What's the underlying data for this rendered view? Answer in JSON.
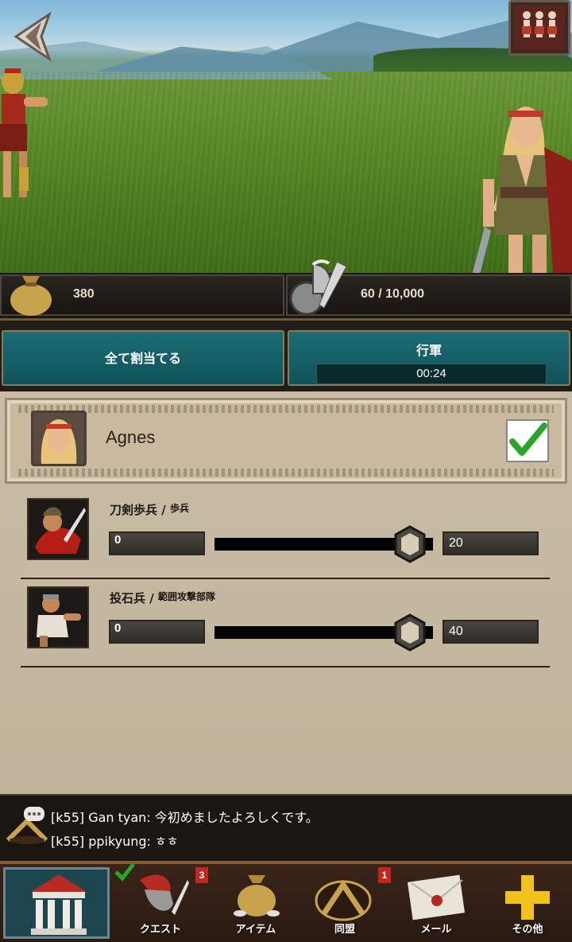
{
  "resources": {
    "gold": "380",
    "troops": "60 / 10,000"
  },
  "actions": {
    "assign_all": "全て割当てる",
    "march": "行軍",
    "march_timer": "00:24"
  },
  "hero": {
    "name": "Agnes",
    "selected": true
  },
  "units": [
    {
      "name": "刀剣歩兵 / ",
      "type": "歩兵",
      "assigned": "0",
      "available": "20",
      "slider_level": 0.9
    },
    {
      "name": "投石兵 / ",
      "type": "範囲攻撃部隊",
      "assigned": "0",
      "available": "40",
      "slider_level": 0.9
    }
  ],
  "chat": [
    "[k55] Gan tyan: 今初めましたよろしくです。",
    "[k55] ppikyung: ㅎㅎ"
  ],
  "nav": {
    "home": "",
    "quest": "クエスト",
    "quest_badge": "3",
    "item": "アイテム",
    "alliance": "同盟",
    "alliance_badge": "1",
    "mail": "メール",
    "other": "その他"
  },
  "colors": {
    "teal_button": "#17616a",
    "panel_bg": "#c2b49b",
    "badge_red": "#c4261e",
    "check_green": "#2aa52a"
  }
}
